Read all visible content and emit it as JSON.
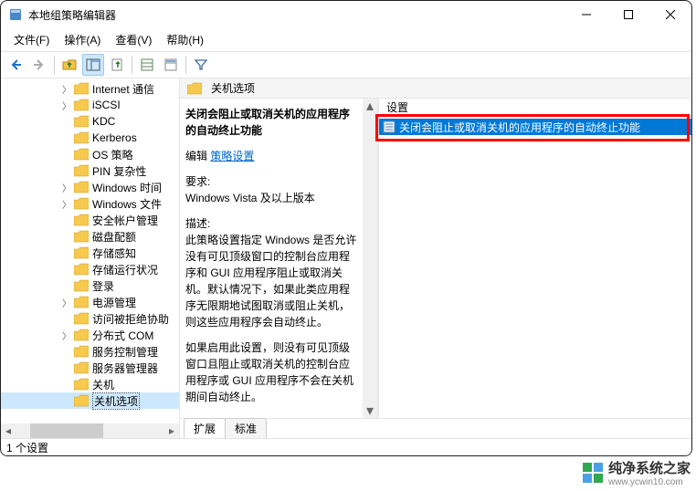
{
  "window": {
    "title": "本地组策略编辑器"
  },
  "menus": {
    "file": "文件(F)",
    "action": "操作(A)",
    "view": "查看(V)",
    "help": "帮助(H)"
  },
  "tree": {
    "items": [
      {
        "label": "Internet 通信",
        "expandable": true
      },
      {
        "label": "iSCSI",
        "expandable": true
      },
      {
        "label": "KDC",
        "expandable": false
      },
      {
        "label": "Kerberos",
        "expandable": false
      },
      {
        "label": "OS 策略",
        "expandable": false
      },
      {
        "label": "PIN 复杂性",
        "expandable": false
      },
      {
        "label": "Windows 时间",
        "expandable": true
      },
      {
        "label": "Windows 文件",
        "expandable": true
      },
      {
        "label": "安全帐户管理",
        "expandable": false
      },
      {
        "label": "磁盘配额",
        "expandable": false
      },
      {
        "label": "存储感知",
        "expandable": false
      },
      {
        "label": "存储运行状况",
        "expandable": false
      },
      {
        "label": "登录",
        "expandable": false
      },
      {
        "label": "电源管理",
        "expandable": true
      },
      {
        "label": "访问被拒绝协助",
        "expandable": false
      },
      {
        "label": "分布式 COM",
        "expandable": true
      },
      {
        "label": "服务控制管理",
        "expandable": false
      },
      {
        "label": "服务器管理器",
        "expandable": false
      },
      {
        "label": "关机",
        "expandable": false
      },
      {
        "label": "关机选项",
        "expandable": false,
        "selected": true
      }
    ]
  },
  "pane": {
    "header": "关机选项",
    "desc": {
      "title": "关闭会阻止或取消关机的应用程序的自动终止功能",
      "edit_label": "编辑",
      "edit_link": "策略设置",
      "req_label": "要求:",
      "req_value": "Windows Vista 及以上版本",
      "desc_label": "描述:",
      "desc_text1": "此策略设置指定 Windows 是否允许没有可见顶级窗口的控制台应用程序和 GUI 应用程序阻止或取消关机。默认情况下，如果此类应用程序无限期地试图取消或阻止关机，则这些应用程序会自动终止。",
      "desc_text2": "如果启用此设置，则没有可见顶级窗口且阻止或取消关机的控制台应用程序或 GUI 应用程序不会在关机期间自动终止。"
    },
    "settings_header": "设置",
    "settings": [
      {
        "label": "关闭会阻止或取消关机的应用程序的自动终止功能",
        "selected": true
      }
    ],
    "tabs": {
      "extended": "扩展",
      "standard": "标准"
    }
  },
  "status": {
    "text": "1 个设置"
  },
  "watermark": {
    "brand": "纯净系统之家",
    "url": "www.ycwin10.com"
  }
}
